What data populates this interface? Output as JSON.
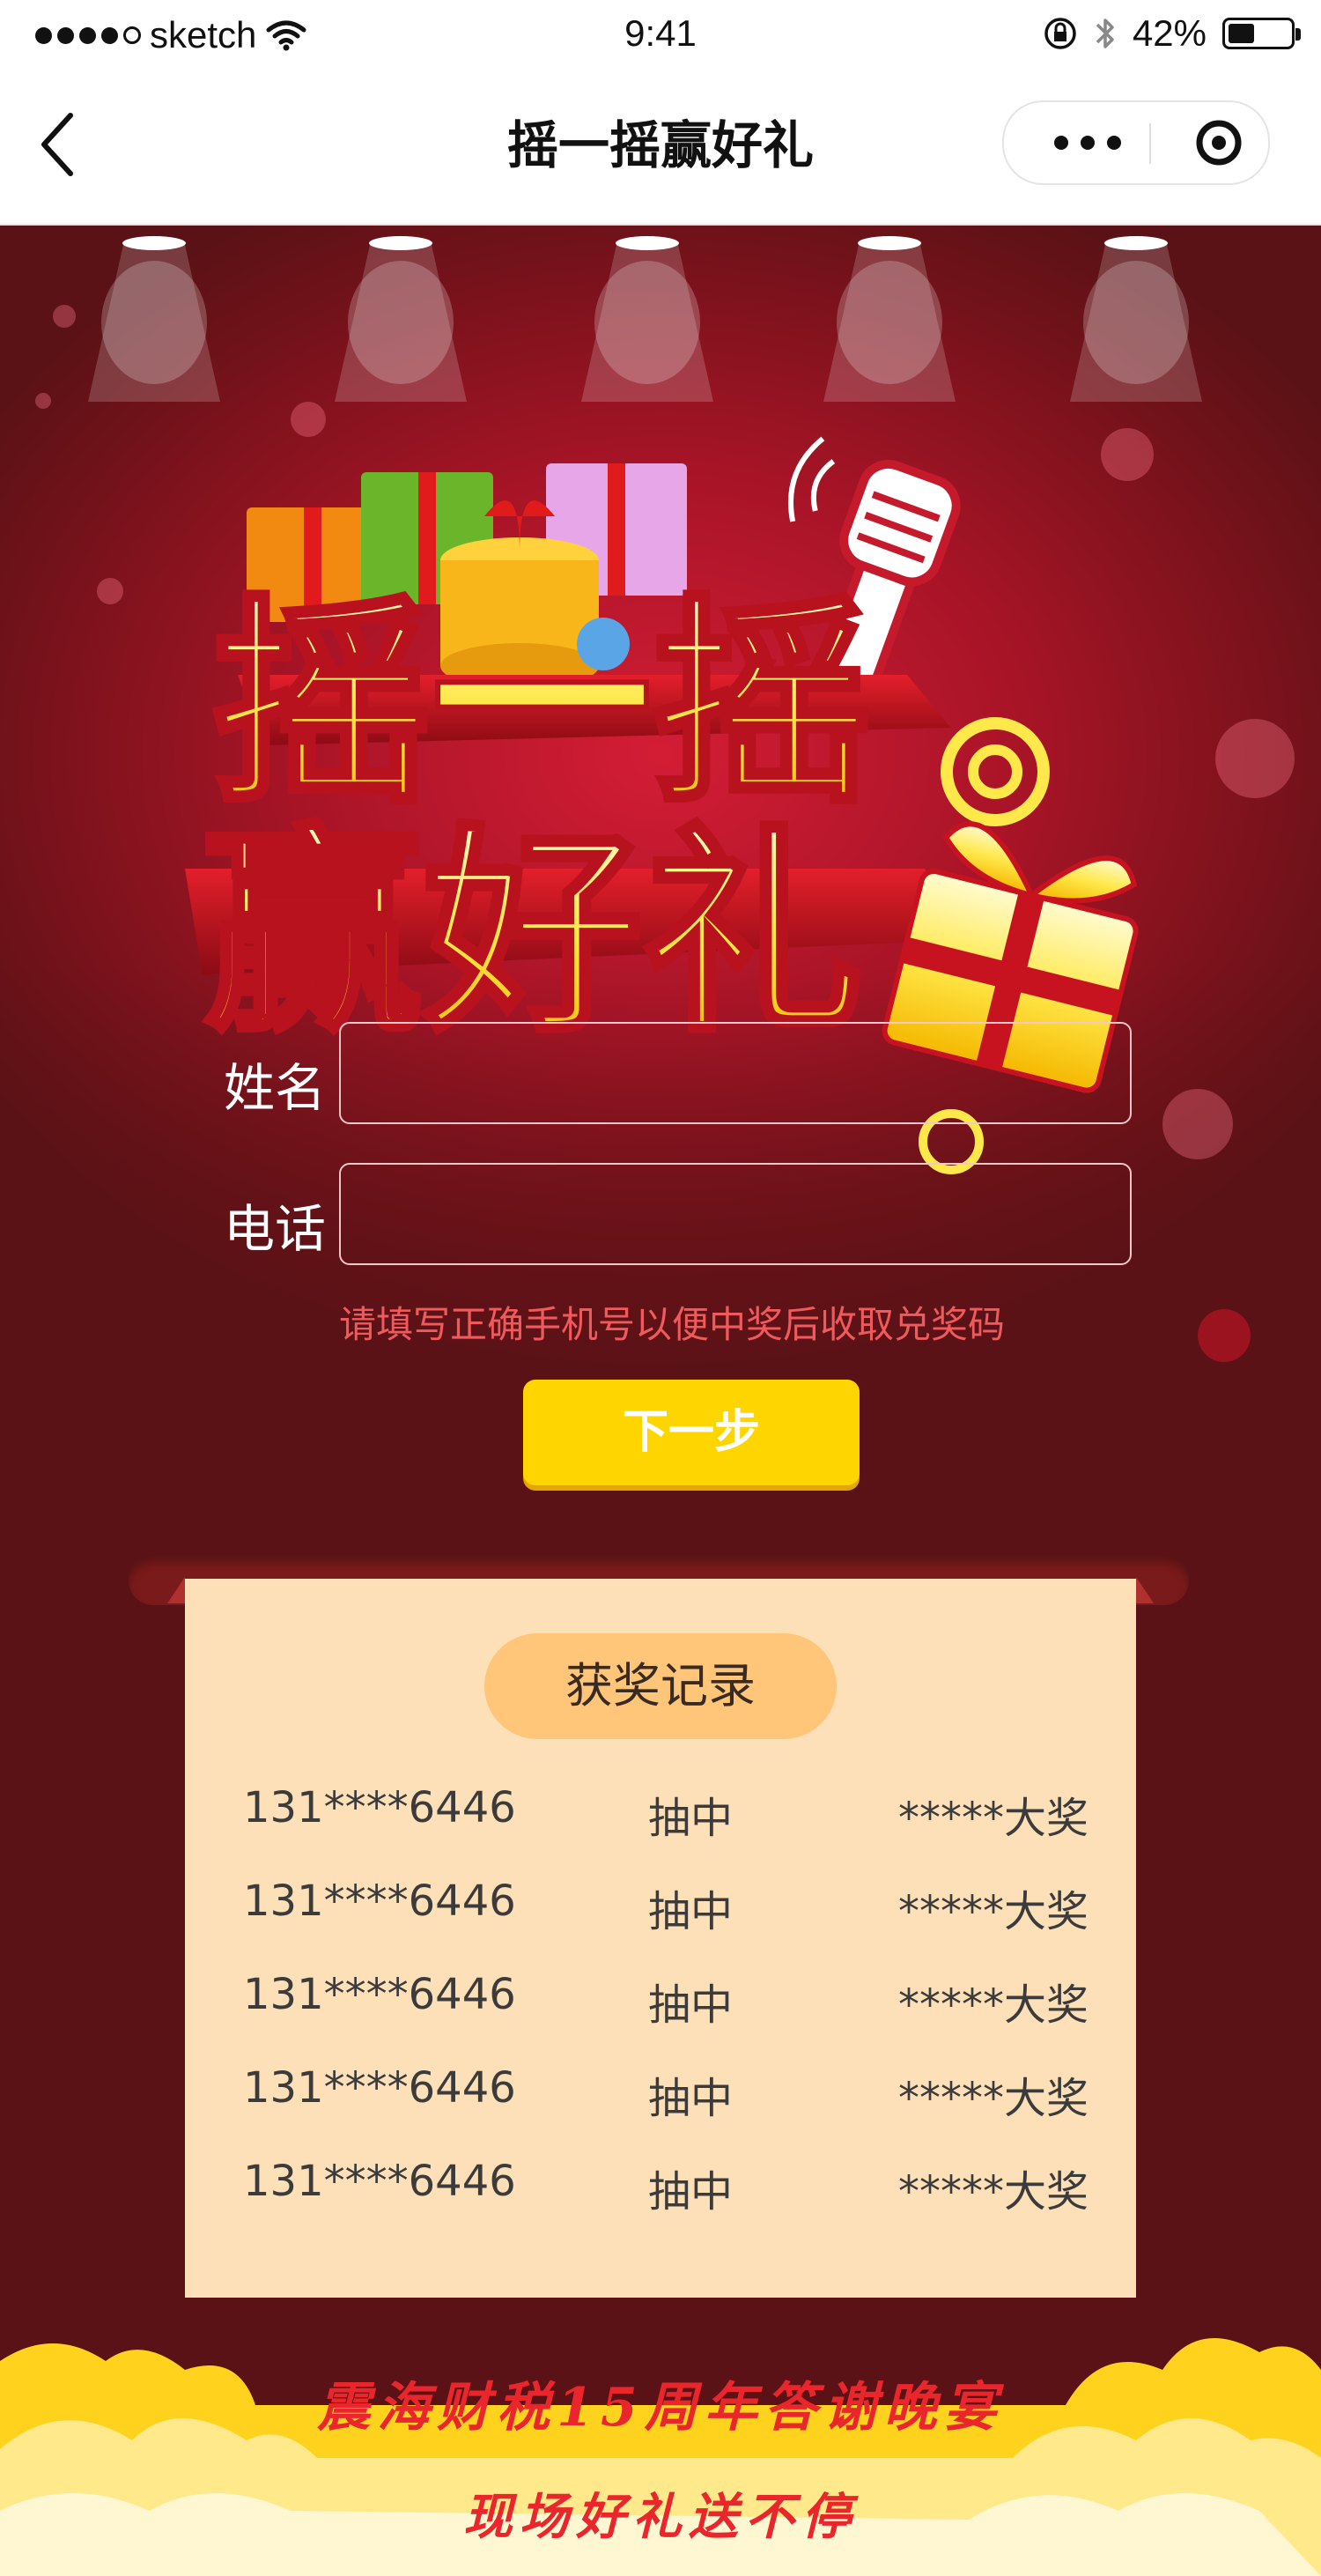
{
  "status_bar": {
    "carrier": "sketch",
    "time": "9:41",
    "battery_percent_text": "42%",
    "battery_level": 0.42
  },
  "nav": {
    "title": "摇一摇赢好礼"
  },
  "poster": {
    "line1": "摇一摇",
    "line2": "赢好礼"
  },
  "form": {
    "name_label": "姓名",
    "name_value": "",
    "phone_label": "电话",
    "phone_value": "",
    "hint": "请填写正确手机号以便中奖后收取兑奖码",
    "next_label": "下一步"
  },
  "records": {
    "title": "获奖记录",
    "rows": [
      {
        "phone": "131****6446",
        "action": "抽中",
        "prize": "*****大奖"
      },
      {
        "phone": "131****6446",
        "action": "抽中",
        "prize": "*****大奖"
      },
      {
        "phone": "131****6446",
        "action": "抽中",
        "prize": "*****大奖"
      },
      {
        "phone": "131****6446",
        "action": "抽中",
        "prize": "*****大奖"
      },
      {
        "phone": "131****6446",
        "action": "抽中",
        "prize": "*****大奖"
      }
    ]
  },
  "footer": {
    "line1": "震海财税15周年答谢晚宴",
    "line2": "现场好礼送不停"
  },
  "colors": {
    "hero_red": "#c51a30",
    "dark_red": "#5b1216",
    "button_yellow": "#ffd500",
    "card_bg": "#fde0b8",
    "title_pill": "#ffc579",
    "hint_red": "#f05a5c",
    "slogan_red": "#e8262b"
  }
}
